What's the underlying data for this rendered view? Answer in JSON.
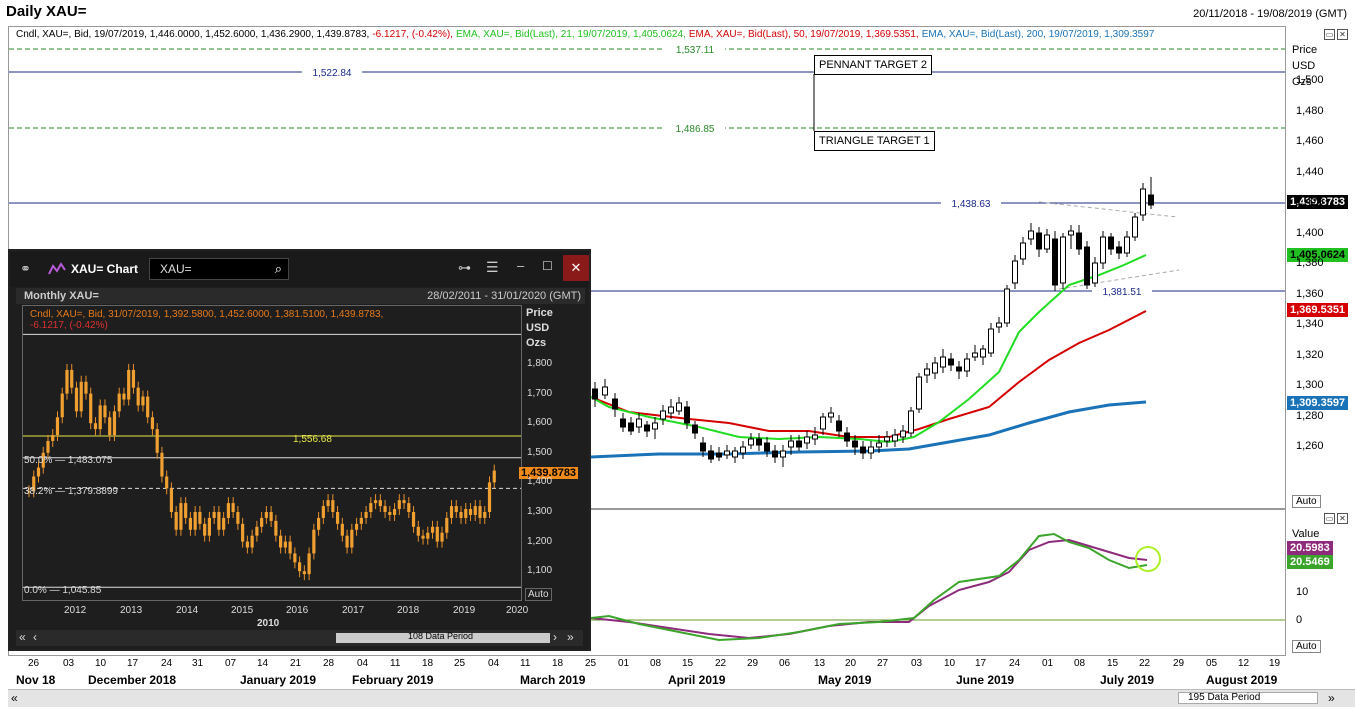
{
  "header": {
    "title": "Daily XAU=",
    "date_range": "20/11/2018 - 19/08/2019 (GMT)"
  },
  "legend": [
    {
      "text": "Cndl, XAU=, Bid, 19/07/2019, 1,446.0000, 1,452.6000, 1,436.2900, 1,439.8783,",
      "color": "#000000"
    },
    {
      "text": "-6.1217, (-0.42%),",
      "color": "#d40000"
    },
    {
      "text": "EMA, XAU=, Bid(Last),  21,  19/07/2019, 1,405.0624,",
      "color": "#1fc01f"
    },
    {
      "text": "EMA, XAU=, Bid(Last),  50,  19/07/2019, 1,369.5351,",
      "color": "#d40000"
    },
    {
      "text": "EMA, XAU=, Bid(Last),  200,  19/07/2019, 1,309.3597",
      "color": "#1a73b8"
    }
  ],
  "price_axis": {
    "header": [
      "Price",
      "USD",
      "Ozs"
    ],
    "ticks": [
      "1,500",
      "1,480",
      "1,460",
      "1,440",
      "1,420",
      "1,400",
      "1,380",
      "1,360",
      "1,340",
      "1,320",
      "1,300",
      "1,280",
      "1,260"
    ],
    "auto": "Auto"
  },
  "levels": [
    {
      "label": "1,537.11",
      "color": "#2a8a2a",
      "style": "dashed"
    },
    {
      "label": "1,522.84",
      "color": "#1a2a8a",
      "style": "solid"
    },
    {
      "label": "1,486.85",
      "color": "#2a8a2a",
      "style": "dashed"
    },
    {
      "label": "1,438.63",
      "color": "#1a2a8a",
      "style": "solid"
    },
    {
      "label": "1,381.51",
      "color": "#1a2a8a",
      "style": "solid"
    }
  ],
  "annotations": {
    "pennant": "PENNANT TARGET 2",
    "triangle": "TRIANGLE TARGET 1"
  },
  "price_tags": [
    {
      "label": "1,439.8783",
      "bg": "#000000",
      "fg": "#ffffff"
    },
    {
      "label": "1,405.0624",
      "bg": "#1fc01f",
      "fg": "#000000"
    },
    {
      "label": "1,369.5351",
      "bg": "#d40000",
      "fg": "#ffffff"
    },
    {
      "label": "1,309.3597",
      "bg": "#1a73b8",
      "fg": "#ffffff"
    }
  ],
  "indicator": {
    "header": "Value",
    "ticks": [
      "10",
      "0"
    ],
    "tags": [
      {
        "label": "20.5983",
        "bg": "#8e2b7c"
      },
      {
        "label": "20.5469",
        "bg": "#3aa52a"
      }
    ],
    "auto": "Auto"
  },
  "x_axis": {
    "days": [
      "26",
      "03",
      "10",
      "17",
      "24",
      "31",
      "07",
      "14",
      "21",
      "28",
      "04",
      "11",
      "18",
      "25",
      "04",
      "11",
      "18",
      "25",
      "01",
      "08",
      "15",
      "22",
      "29",
      "06",
      "13",
      "20",
      "27",
      "03",
      "10",
      "17",
      "24",
      "01",
      "08",
      "15",
      "22",
      "29",
      "05",
      "12",
      "19"
    ],
    "months": [
      "Nov 18",
      "December 2018",
      "January 2019",
      "February 2019",
      "March 2019",
      "April 2019",
      "May 2019",
      "June 2019",
      "July 2019",
      "August 2019"
    ],
    "period": "195 Data Period"
  },
  "inset": {
    "title": "XAU= Chart",
    "search_value": "XAU=",
    "subtitle": "Monthly XAU=",
    "date_range": "28/02/2011 - 31/01/2020 (GMT)",
    "legend_black": "Cndl, XAU=, Bid, 31/07/2019, 1,392.5800, 1,452.6000, 1,381.5100, 1,439.8783,",
    "legend_red": "-6.1217, (-0.42%)",
    "axis_header": [
      "Price",
      "USD",
      "Ozs"
    ],
    "ticks": [
      "1,800",
      "1,700",
      "1,600",
      "1,500",
      "1,400",
      "1,300",
      "1,200",
      "1,100"
    ],
    "fib": [
      "50.0% — 1,483.075",
      "38.2% — 1,379.8899",
      "0.0% — 1,045.85"
    ],
    "yellow_level": "1,556.68",
    "price_tag": "1,439.8783",
    "auto": "Auto",
    "years": [
      "2012",
      "2013",
      "2014",
      "2015",
      "2016",
      "2017",
      "2018",
      "2019",
      "2020"
    ],
    "year_label": "2010",
    "period": "108 Data Period"
  }
}
